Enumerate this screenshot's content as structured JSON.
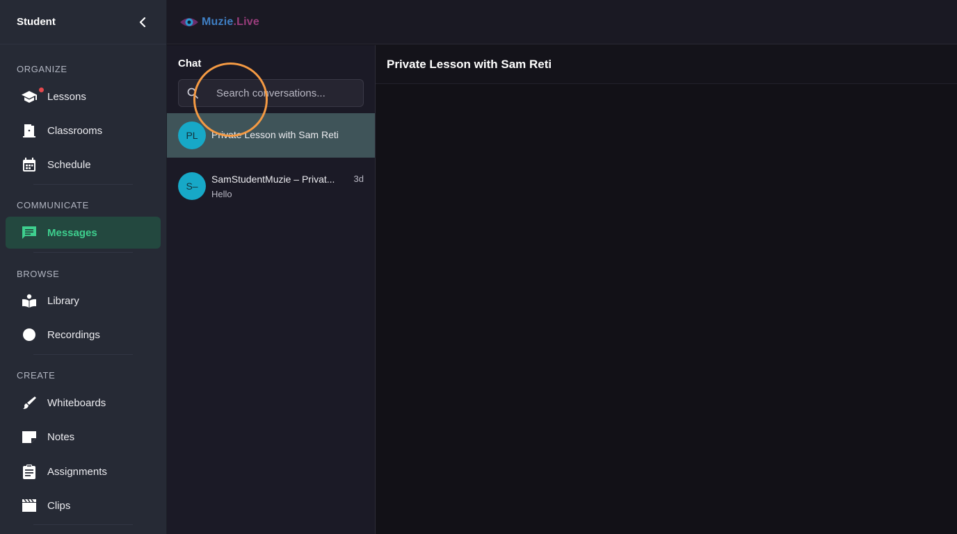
{
  "sidebar": {
    "title": "Student",
    "sections": [
      {
        "label": "ORGANIZE"
      },
      {
        "label": "COMMUNICATE"
      },
      {
        "label": "BROWSE"
      },
      {
        "label": "CREATE"
      }
    ],
    "items": [
      {
        "label": "Lessons",
        "icon": "graduation-cap-icon"
      },
      {
        "label": "Classrooms",
        "icon": "door-icon"
      },
      {
        "label": "Schedule",
        "icon": "calendar-icon"
      },
      {
        "label": "Messages",
        "icon": "message-icon"
      },
      {
        "label": "Library",
        "icon": "reader-icon"
      },
      {
        "label": "Recordings",
        "icon": "record-dot-icon"
      },
      {
        "label": "Whiteboards",
        "icon": "brush-icon"
      },
      {
        "label": "Notes",
        "icon": "note-icon"
      },
      {
        "label": "Assignments",
        "icon": "clipboard-icon"
      },
      {
        "label": "Clips",
        "icon": "clapperboard-icon"
      }
    ],
    "active_item": "Messages",
    "accent_color": "#3ecf8e"
  },
  "topbar": {
    "logo_text": "Muzie",
    "logo_suffix": ".Live"
  },
  "chat": {
    "title": "Chat",
    "search_placeholder": "Search conversations...",
    "conversations": [
      {
        "initials": "PL",
        "name": "Private Lesson with Sam Reti",
        "preview": "",
        "time": "",
        "selected": true
      },
      {
        "initials": "S–",
        "name": "SamStudentMuzie – Privat...",
        "preview": "Hello",
        "time": "3d",
        "selected": false
      }
    ]
  },
  "main": {
    "title": "Private Lesson with Sam Reti"
  }
}
